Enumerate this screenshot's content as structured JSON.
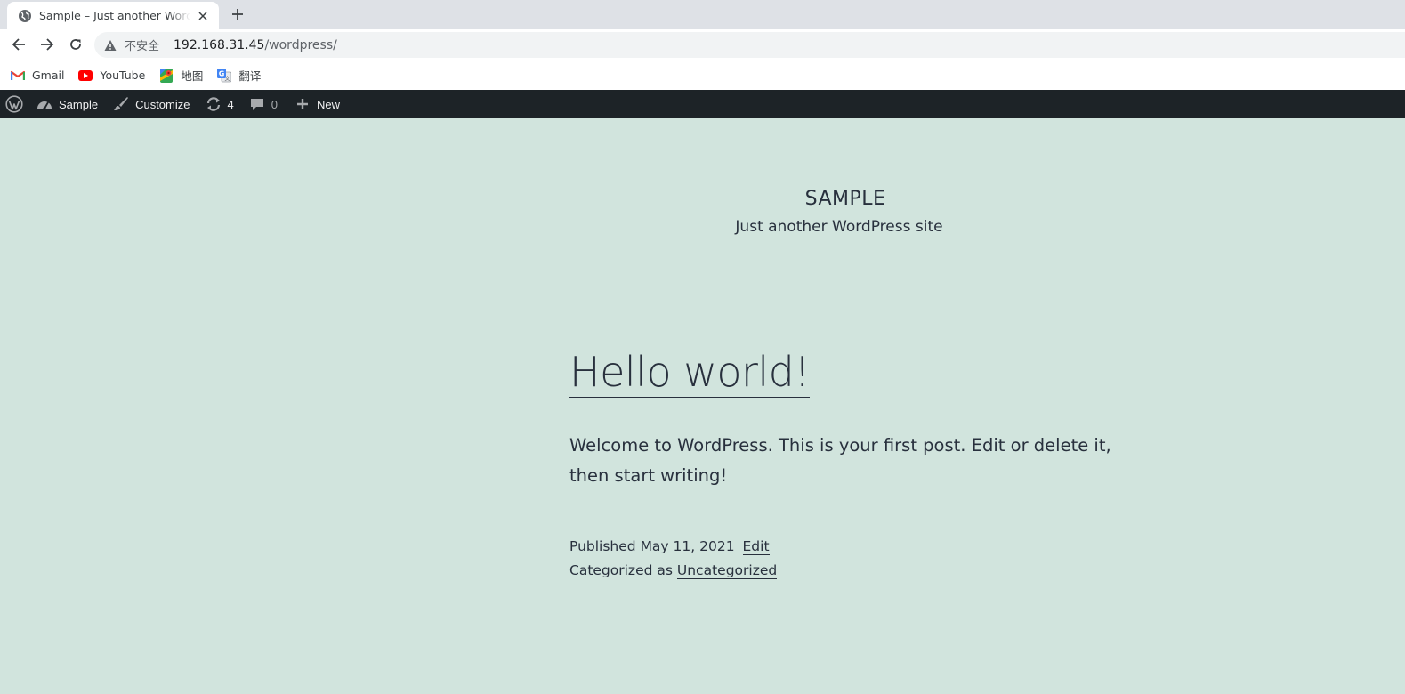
{
  "browser": {
    "tab": {
      "title": "Sample – Just another WordPress site",
      "favicon": "globe-icon"
    },
    "address": {
      "security_label": "不安全",
      "host": "192.168.31.45",
      "path": "/wordpress/"
    },
    "bookmarks": [
      {
        "label": "Gmail",
        "icon": "gmail-icon"
      },
      {
        "label": "YouTube",
        "icon": "youtube-icon"
      },
      {
        "label": "地图",
        "icon": "maps-icon"
      },
      {
        "label": "翻译",
        "icon": "translate-icon"
      }
    ]
  },
  "adminbar": {
    "site_label": "Sample",
    "customize_label": "Customize",
    "updates_count": "4",
    "comments_count": "0",
    "new_label": "New"
  },
  "site": {
    "title": "SAMPLE",
    "description": "Just another WordPress site"
  },
  "post": {
    "title": "Hello world!",
    "body": "Welcome to WordPress. This is your first post. Edit or delete it, then start writing!",
    "published_prefix": "Published",
    "published_date": "May 11, 2021",
    "edit_label": "Edit",
    "categorized_prefix": "Categorized as",
    "category": "Uncategorized"
  },
  "colors": {
    "page_background": "#d1e4dd",
    "text": "#28303d",
    "adminbar_background": "#1d2327"
  }
}
